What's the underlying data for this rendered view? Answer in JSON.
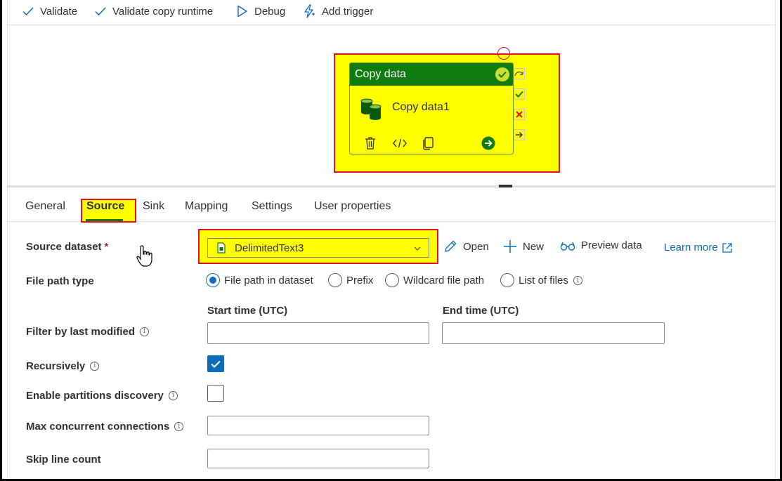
{
  "toolbar": {
    "validate_label": "Validate",
    "validate_copy_runtime_label": "Validate copy runtime",
    "debug_label": "Debug",
    "add_trigger_label": "Add trigger"
  },
  "activity": {
    "type_label": "Copy data",
    "name": "Copy data1"
  },
  "tabs": {
    "general": "General",
    "source": "Source",
    "sink": "Sink",
    "mapping": "Mapping",
    "settings": "Settings",
    "user_properties": "User properties",
    "active": "Source"
  },
  "form": {
    "source_dataset_label": "Source dataset",
    "required_mark": "*",
    "dataset_value": "DelimitedText3",
    "open_label": "Open",
    "new_label": "New",
    "preview_label": "Preview data",
    "learn_more_label": "Learn more",
    "file_path_type_label": "File path type",
    "file_path_options": [
      "File path in dataset",
      "Prefix",
      "Wildcard file path",
      "List of files"
    ],
    "file_path_selected": "File path in dataset",
    "start_time_label": "Start time (UTC)",
    "end_time_label": "End time (UTC)",
    "filter_label": "Filter by last modified",
    "start_time_value": "",
    "end_time_value": "",
    "recursively_label": "Recursively",
    "recursively_checked": true,
    "partitions_label": "Enable partitions discovery",
    "partitions_checked": false,
    "max_connections_label": "Max concurrent connections",
    "max_connections_value": "",
    "skip_line_label": "Skip line count",
    "skip_line_value": "",
    "info_glyph": "i"
  },
  "colors": {
    "highlight": "#ffff00",
    "highlight_border": "#e81123",
    "activity_header": "#107c10",
    "accent": "#0f6cbd"
  }
}
